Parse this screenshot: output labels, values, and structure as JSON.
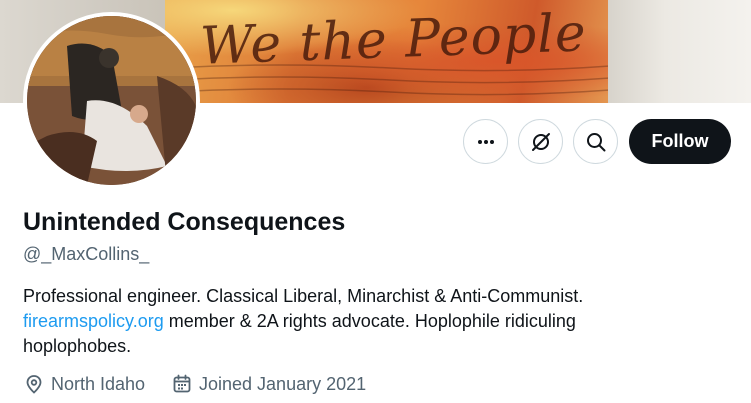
{
  "banner": {
    "script_text": "We the People",
    "icon": "banner-image"
  },
  "avatar": {
    "icon": "profile-avatar-image"
  },
  "actions": {
    "more_icon": "more-horizontal-icon",
    "grok_icon": "grok-icon",
    "search_icon": "search-icon",
    "follow_label": "Follow"
  },
  "profile": {
    "display_name": "Unintended Consequences",
    "handle": "@_MaxCollins_",
    "bio_line1": "Professional engineer. Classical Liberal, Minarchist & Anti-Communist.",
    "bio_link": "firearmspolicy.org",
    "bio_line2_rest": " member & 2A rights advocate. Hoplophile ridiculing",
    "bio_line3": "hoplophobes.",
    "location": "North Idaho",
    "location_icon": "location-pin-icon",
    "joined": "Joined January 2021",
    "joined_icon": "calendar-icon"
  },
  "colors": {
    "text_primary": "#0f1419",
    "text_secondary": "#536471",
    "link": "#1d9bf0",
    "follow_bg": "#0f1419",
    "border": "#cfd9de"
  }
}
